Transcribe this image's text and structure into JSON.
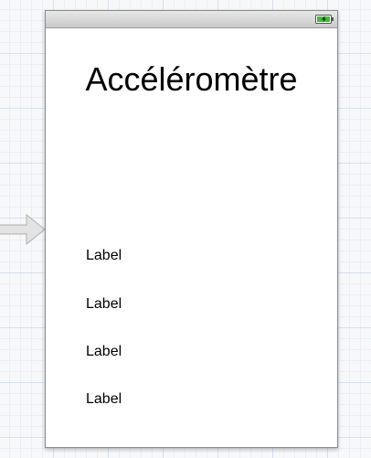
{
  "scene": {
    "title": "Accéléromètre",
    "labels": [
      "Label",
      "Label",
      "Label",
      "Label"
    ]
  },
  "status_bar": {
    "battery_icon": "battery-charging-icon"
  },
  "colors": {
    "battery_fill": "#3fbf2f",
    "canvas_grid": "#d7e0ea"
  }
}
